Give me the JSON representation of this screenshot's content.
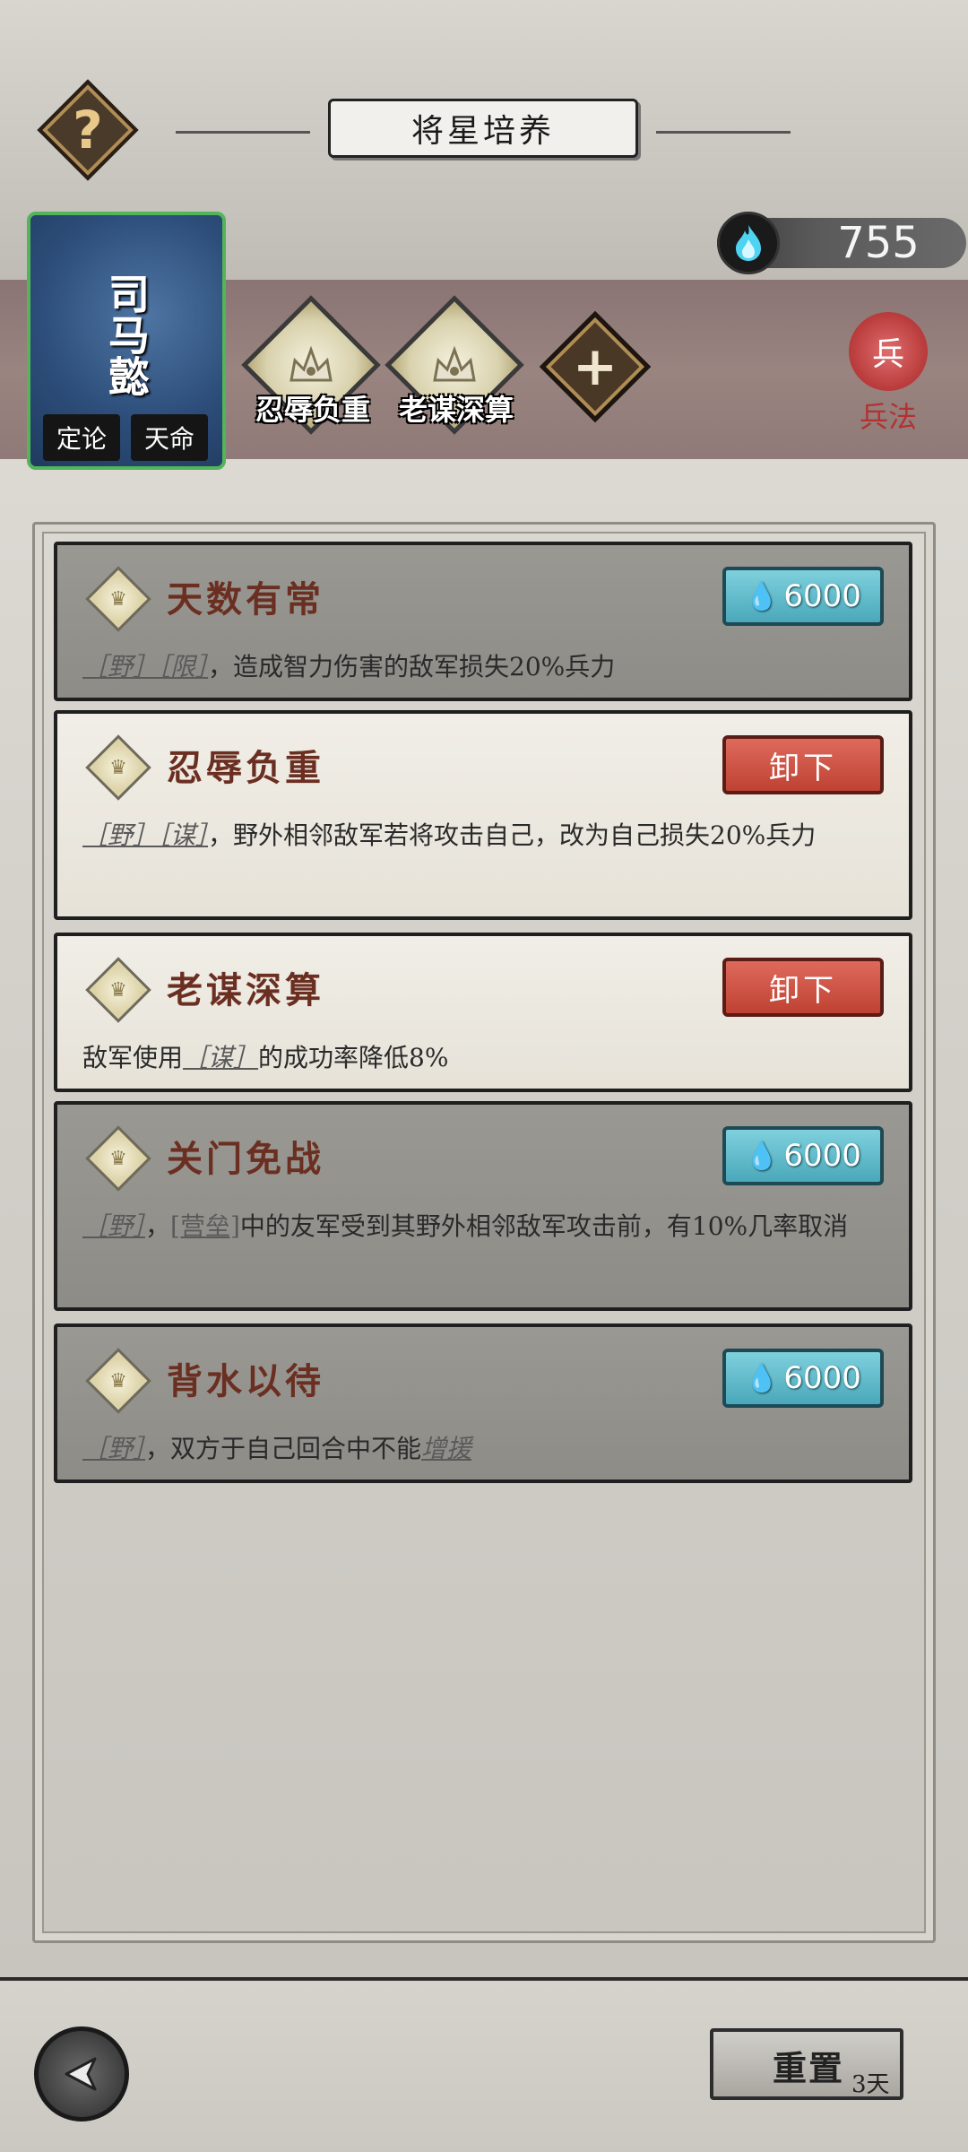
{
  "header": {
    "title": "将星培养",
    "help_icon": "?"
  },
  "currency": {
    "icon": "blue-flame-icon",
    "value": "755"
  },
  "general": {
    "name": "司马懿",
    "tags": [
      "定论",
      "天命"
    ]
  },
  "equipped_skills": [
    {
      "label": "忍辱负重"
    },
    {
      "label": "老谋深算"
    }
  ],
  "add_slot_symbol": "+",
  "bingfa": {
    "seal_text": "兵",
    "label": "兵法"
  },
  "skills": [
    {
      "title": "天数有常",
      "state": "locked",
      "cost": "6000",
      "desc_parts": [
        "［野］",
        "［限］",
        "，造成智力伤害的敌军损失20%兵力"
      ]
    },
    {
      "title": "忍辱负重",
      "state": "equipped",
      "action": "卸下",
      "desc_parts": [
        "［野］",
        "［谋］",
        "，野外相邻敌军若将攻击自己，改为自己损失20%兵力"
      ]
    },
    {
      "title": "老谋深算",
      "state": "equipped",
      "action": "卸下",
      "desc_parts": [
        "敌军使用",
        "［谋］",
        "的成功率降低8%"
      ]
    },
    {
      "title": "关门免战",
      "state": "locked",
      "cost": "6000",
      "desc_parts": [
        "［野］",
        "，",
        "[营垒]",
        "中的友军受到其野外相邻敌军攻击前，有10%几率取消"
      ]
    },
    {
      "title": "背水以待",
      "state": "locked",
      "cost": "6000",
      "desc_parts": [
        "［野］",
        "，双方于自己回合中不能",
        "增援"
      ]
    }
  ],
  "footer": {
    "reset_label": "重置",
    "reset_days": "3天"
  },
  "colors": {
    "cost_button": "#4aa8ba",
    "unequip_button": "#bf4233",
    "skill_title": "#6b2f22",
    "general_border": "#52b55a"
  }
}
